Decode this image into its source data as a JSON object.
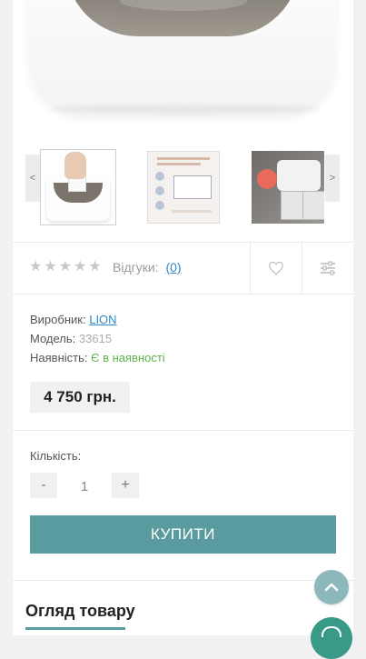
{
  "gallery": {
    "prev_label": "<",
    "next_label": ">",
    "thumbnails": [
      "thumb-wipe-warmer-hand",
      "thumb-infographic",
      "thumb-product-photo"
    ]
  },
  "rating": {
    "stars_filled": 0,
    "stars_total": 5,
    "reviews_label": "Відгуки:",
    "reviews_count": "(0)"
  },
  "product": {
    "manufacturer_label": "Виробник:",
    "manufacturer": "LION",
    "model_label": "Модель:",
    "model": "33615",
    "availability_label": "Наявність:",
    "availability": "Є в наявності",
    "price": "4 750 грн."
  },
  "quantity": {
    "label": "Кількість:",
    "minus": "-",
    "value": "1",
    "plus": "+"
  },
  "buy_label": "КУПИТИ",
  "overview_title": "Огляд товару",
  "icons": {
    "wishlist": "heart-icon",
    "compare": "sliders-icon",
    "scroll_top": "chevron-up-icon",
    "chat": "chat-icon"
  },
  "colors": {
    "accent": "#5a9b9f",
    "link": "#2f86c9",
    "in_stock": "#5fb24b"
  }
}
